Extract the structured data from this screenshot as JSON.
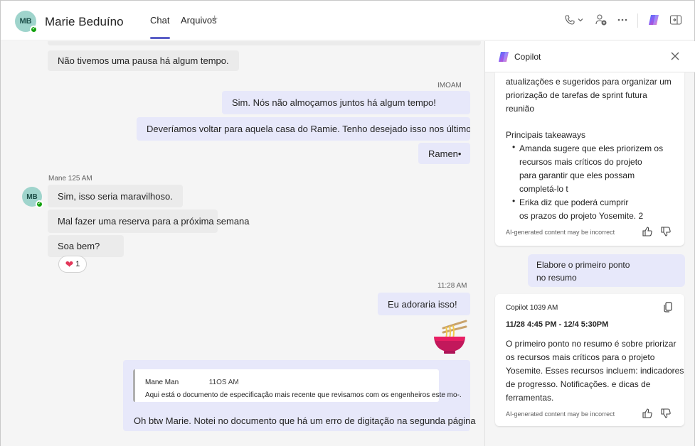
{
  "header": {
    "avatar_initials": "MB",
    "contact_name": "Marie Beduíno",
    "tabs": [
      {
        "label": "Chat",
        "active": true
      },
      {
        "label": "Arquivos",
        "active": false
      }
    ],
    "add_tab": "+",
    "icons": [
      "phone-icon",
      "chevron-down-icon",
      "add-people-icon",
      "more-icon",
      "copilot-icon",
      "open-pane-icon"
    ]
  },
  "chat": {
    "messages": [
      {
        "id": "m1",
        "direction": "in",
        "text": "Não tivemos uma pausa há algum tempo."
      },
      {
        "id": "m2",
        "direction": "out",
        "meta": "IMOAM",
        "text": "Sim. Nós não almoçamos juntos há algum tempo!"
      },
      {
        "id": "m3",
        "direction": "out",
        "text": "Deveríamos voltar para aquela casa do Ramie. Tenho desejado isso nos últimos dias."
      },
      {
        "id": "m4",
        "direction": "out",
        "text": "Ramen•"
      },
      {
        "id": "m5",
        "direction": "in",
        "meta": "Mane 125 AM",
        "avatar_initials": "MB",
        "text": "Sim, isso seria maravilhoso."
      },
      {
        "id": "m6",
        "direction": "in",
        "text": "Mal fazer uma reserva para a próxima semana"
      },
      {
        "id": "m7",
        "direction": "in",
        "text": "Soa bem?",
        "reaction": {
          "emoji": "❤",
          "count": "1"
        }
      },
      {
        "id": "m8",
        "direction": "out",
        "meta": "11:28 AM",
        "text": "Eu adoraria isso!"
      }
    ],
    "quoted": {
      "author": "Mane Man",
      "time": "11OS AM",
      "text": "Aqui está o documento de especificação mais recente que revisamos com os engenheiros este mo-.",
      "reply": "Oh btw Marie. Notei no documento que há um erro de digitação na segunda página"
    }
  },
  "copilot": {
    "title": "Copilot",
    "card1": {
      "lines": [
        "atualizações e sugeridos para organizar um",
        "priorização de tarefas de sprint futura",
        "reunião"
      ],
      "heading": "Principais takeaways",
      "bullet1": [
        "Amanda sugere que eles priorizem os",
        "recursos mais críticos do projeto",
        "para garantir que eles possam",
        "completá-lo t"
      ],
      "bullet2": [
        "Erika diz que poderá cumprir",
        "os prazos do projeto Yosemite. 2"
      ],
      "ai_note": "AI-generated content may be incorrect"
    },
    "prompt": [
      "Elabore o primeiro ponto",
      "no resumo"
    ],
    "card2": {
      "meta": "Copilot 1039 AM",
      "range": "11/28 4:45 PM - 12/4 5:30PM",
      "body": [
        "O primeiro ponto no resumo é sobre priorizar",
        "os recursos mais críticos para o projeto",
        "Yosemite. Esses recursos incluem: indicadores",
        "de progresso. Notificações. e dicas de",
        "ferramentas."
      ],
      "ai_note": "AI-generated content may be incorrect"
    }
  },
  "colors": {
    "accent": "#5b5fc7",
    "outgoing_bubble": "#e7e8fa",
    "incoming_bubble": "#ebebeb",
    "presence": "#13a10e",
    "heart": "#e3385a"
  }
}
